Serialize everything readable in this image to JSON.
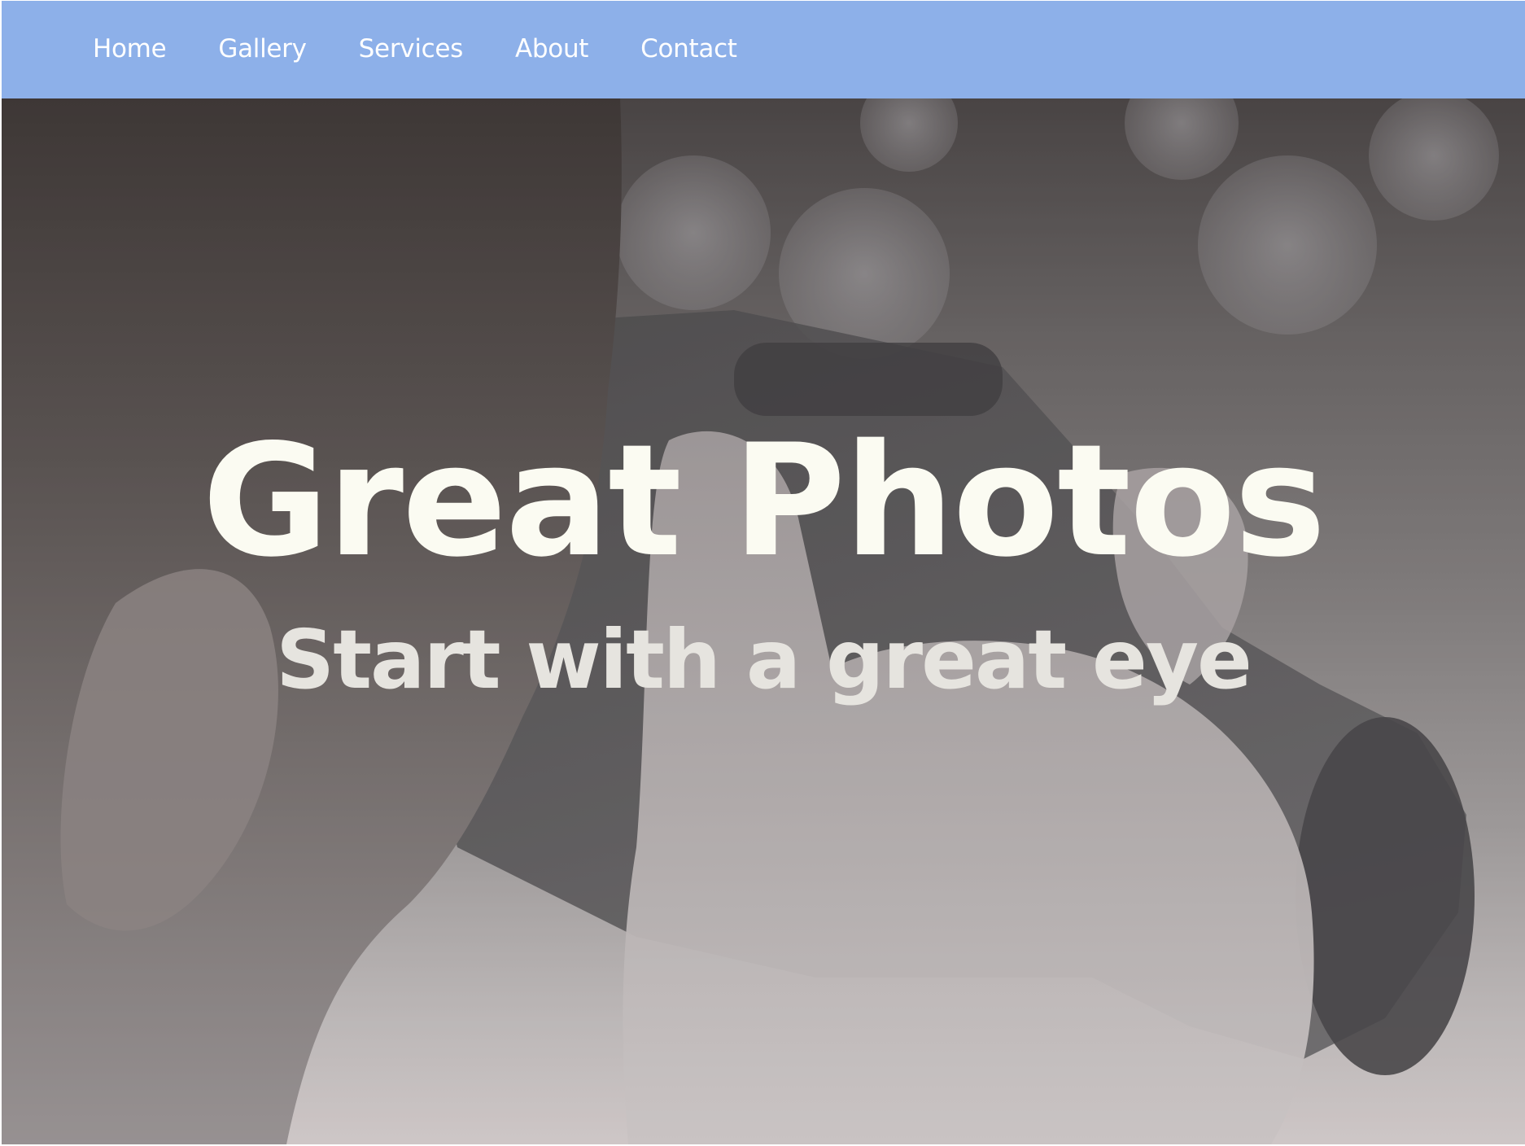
{
  "nav": {
    "items": [
      {
        "label": "Home"
      },
      {
        "label": "Gallery"
      },
      {
        "label": "Services"
      },
      {
        "label": "About"
      },
      {
        "label": "Contact"
      }
    ]
  },
  "hero": {
    "title": "Great Photos",
    "subtitle": "Start with a great eye",
    "image": "person-with-camera-photo"
  },
  "colors": {
    "nav_background": "#8db0e9",
    "nav_text": "#ffffff",
    "title_text": "#fbfbf2",
    "subtitle_text": "#e6e4df"
  }
}
